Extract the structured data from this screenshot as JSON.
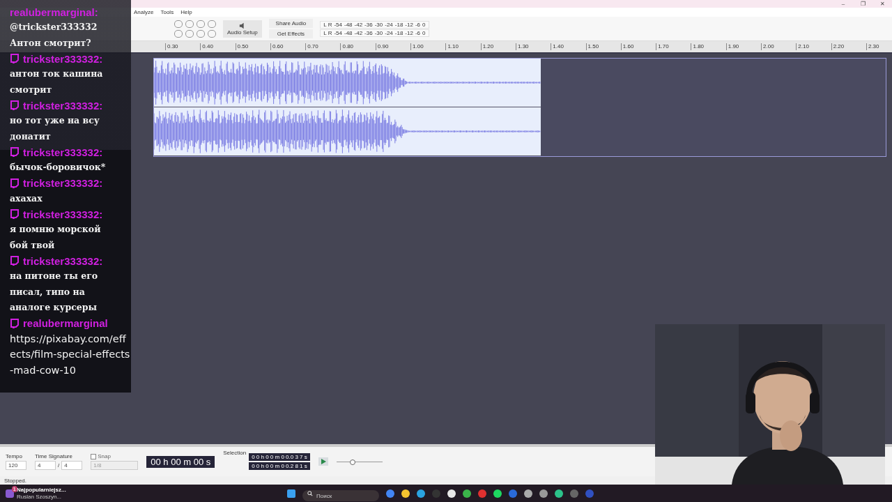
{
  "window": {
    "menu": [
      "Analyze",
      "Tools",
      "Help"
    ],
    "controls": [
      "–",
      "❐",
      "✕"
    ]
  },
  "toolbar": {
    "share_audio": "Share Audio",
    "get_effects": "Get Effects",
    "audio_setup": "Audio Setup",
    "meters": [
      {
        "channels": [
          "L",
          "R"
        ],
        "scale": [
          "-54",
          "-48",
          "-42",
          "-36",
          "-30",
          "-24",
          "-18",
          "-12",
          "-6",
          "0"
        ]
      },
      {
        "channels": [
          "L",
          "R"
        ],
        "scale": [
          "-54",
          "-48",
          "-42",
          "-36",
          "-30",
          "-24",
          "-18",
          "-12",
          "-6",
          "0"
        ]
      }
    ]
  },
  "ruler": [
    "0.30",
    "0.40",
    "0.50",
    "0.60",
    "0.70",
    "0.80",
    "0.90",
    "1.00",
    "1.10",
    "1.20",
    "1.30",
    "1.40",
    "1.50",
    "1.60",
    "1.70",
    "1.80",
    "1.90",
    "2.00",
    "2.10",
    "2.20",
    "2.30"
  ],
  "bottom_toolbar": {
    "tempo_label": "Tempo",
    "tempo": "120",
    "time_signature_label": "Time Signature",
    "beats": "4",
    "slash": "/",
    "unit": "4",
    "snap": {
      "label": "Snap",
      "checked": false
    },
    "snap_value": "1/8",
    "time": "00 h 00 m 00 s",
    "selection_label": "Selection",
    "selection_start": "0 0 h 0 0 m 0 0.0 3 7 s",
    "selection_end": "0 0 h 0 0 m 0 0.2 8 1 s",
    "speed": {
      "level": 0.35
    }
  },
  "status_bar": "Stopped.",
  "chat": [
    {
      "user": "realubermarginal:",
      "text": "@trickster333332 Антон смотрит?",
      "icon": false
    },
    {
      "user": "trickster333332:",
      "text": "антон ток кашина смотрит",
      "icon": true
    },
    {
      "user": "trickster333332:",
      "text": "но тот уже на всу донатит",
      "icon": true
    },
    {
      "user": "trickster333332:",
      "text": "бычок-боровичок*",
      "icon": true
    },
    {
      "user": "trickster333332:",
      "text": "ахахах",
      "icon": true
    },
    {
      "user": "trickster333332:",
      "text": "я помню морской бой твой",
      "icon": true
    },
    {
      "user": "trickster333332:",
      "text": "на питоне ты его писал, типо на аналоге курсеры",
      "icon": true
    },
    {
      "user": "realubermarginal",
      "text": "https://pixabay.com/effects/film-special-effects-mad-cow-10",
      "icon": true
    }
  ],
  "taskbar": {
    "notification": {
      "badge": "1",
      "title": "Najpopularniejsz...",
      "subtitle": "Ruslan Szoszyn..."
    },
    "search": {
      "placeholder": "Поиск"
    }
  }
}
